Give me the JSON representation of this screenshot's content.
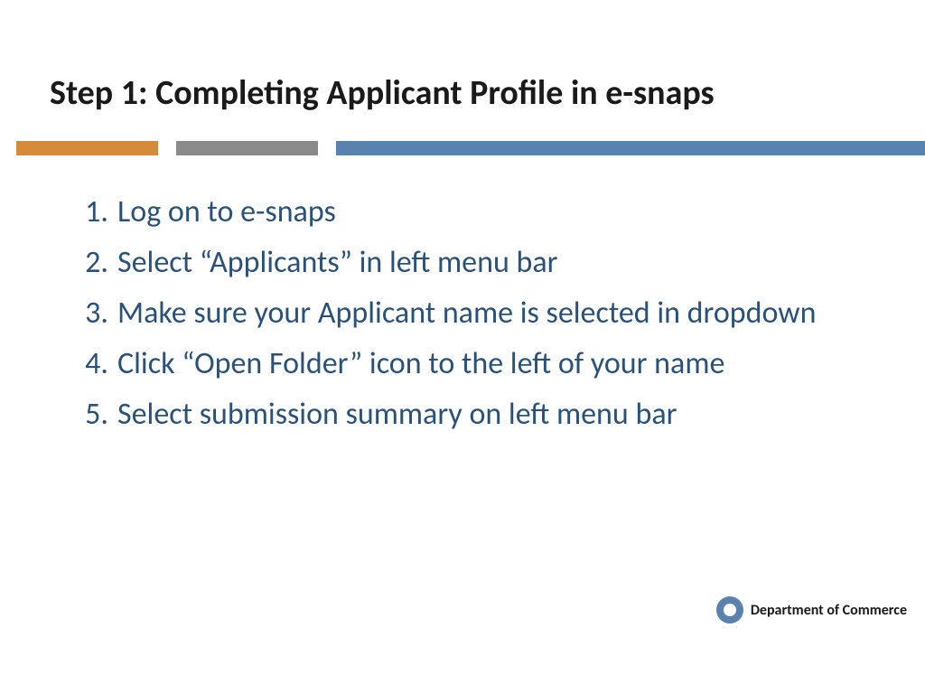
{
  "title": "Step 1: Completing Applicant Profile in e-snaps",
  "steps": [
    "Log on to e-snaps",
    "Select “Applicants” in left menu bar",
    "Make sure your Applicant name is selected in dropdown",
    "Click “Open Folder” icon to the left of your name",
    "Select submission summary on left menu bar"
  ],
  "footer": {
    "label": "Department of Commerce"
  },
  "colors": {
    "orange": "#d68b3a",
    "gray": "#8a8a8a",
    "blue": "#5a82af",
    "text_blue": "#2a5178"
  }
}
